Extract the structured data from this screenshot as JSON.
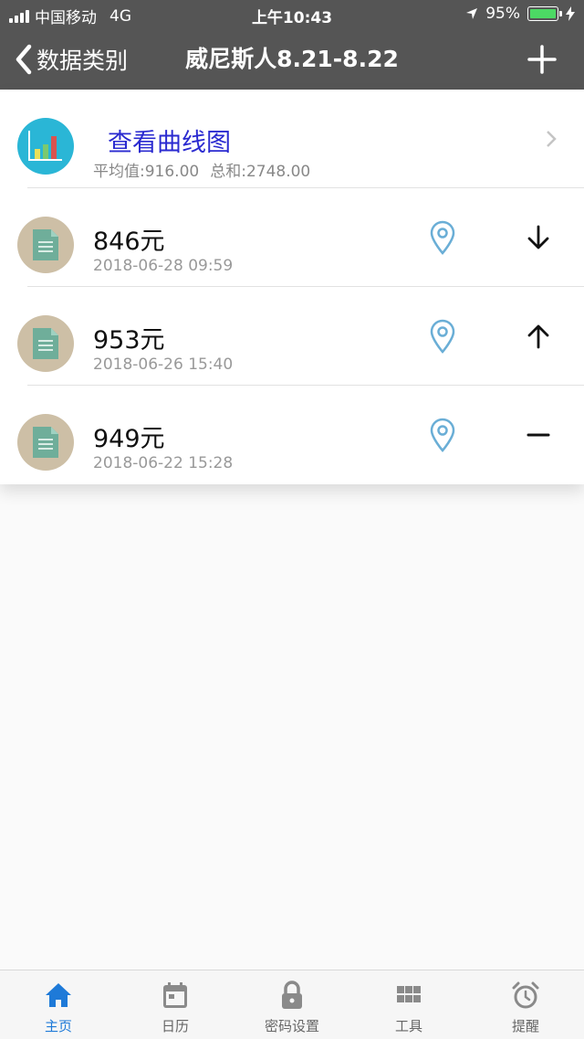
{
  "status": {
    "carrier": "中国移动",
    "network": "4G",
    "time": "上午10:43",
    "battery": "95%",
    "battery_level": 0.95
  },
  "nav": {
    "back_label": "数据类别",
    "title": "威尼斯人8.21-8.22"
  },
  "chart_row": {
    "title": "查看曲线图",
    "avg": "平均值:916.00",
    "sum": "总和:2748.00"
  },
  "records": [
    {
      "value": "846元",
      "time": "2018-06-28 09:59",
      "trend": "down"
    },
    {
      "value": "953元",
      "time": "2018-06-26 15:40",
      "trend": "up"
    },
    {
      "value": "949元",
      "time": "2018-06-22 15:28",
      "trend": "flat"
    }
  ],
  "tabs": [
    {
      "label": "主页",
      "icon": "home-icon",
      "active": true
    },
    {
      "label": "日历",
      "icon": "calendar-icon",
      "active": false
    },
    {
      "label": "密码设置",
      "icon": "lock-icon",
      "active": false
    },
    {
      "label": "工具",
      "icon": "grid-icon",
      "active": false
    },
    {
      "label": "提醒",
      "icon": "alarm-icon",
      "active": false
    }
  ],
  "colors": {
    "bar": "#555555",
    "accent": "#1e7ad8",
    "link": "#2a2ad0",
    "pin": "#6aaed6"
  }
}
